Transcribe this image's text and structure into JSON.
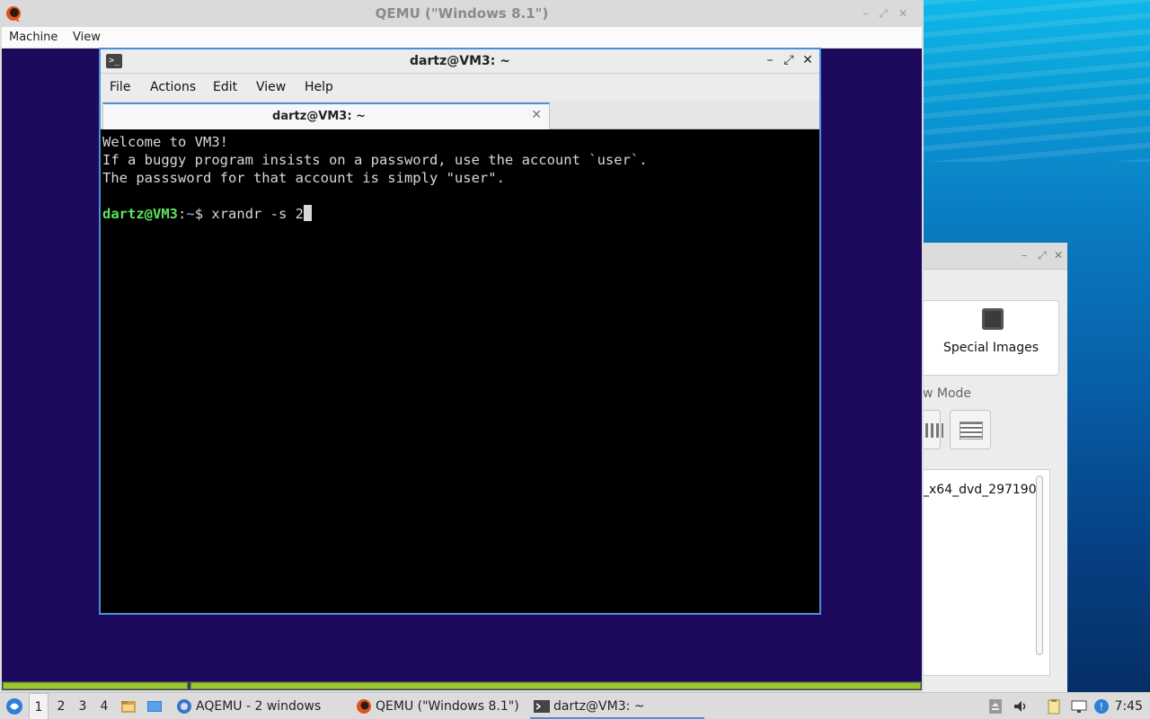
{
  "qemu": {
    "title": "QEMU (\"Windows 8.1\")",
    "menu": [
      "Machine",
      "View"
    ]
  },
  "terminal": {
    "title": "dartz@VM3: ~",
    "menu": [
      "File",
      "Actions",
      "Edit",
      "View",
      "Help"
    ],
    "tab_label": "dartz@VM3: ~",
    "lines": [
      "Welcome to VM3!",
      "If a buggy program insists on a password, use the account `user`.",
      "The passsword for that account is simply \"user\"."
    ],
    "prompt_user": "dartz@VM3",
    "prompt_sep": ":",
    "prompt_path": "~",
    "prompt_symbol": "$",
    "command": " xrandr -s 2"
  },
  "background_window": {
    "special_images_label": "Special Images",
    "view_mode_label": "w Mode",
    "list_item": "_x64_dvd_297190"
  },
  "taskbar": {
    "workspaces": [
      "1",
      "2",
      "3",
      "4"
    ],
    "active_workspace": "1",
    "tasks": [
      {
        "label": "AQEMU - 2 windows",
        "icon": "aqemu-icon"
      },
      {
        "label": "QEMU (\"Windows 8.1\")",
        "icon": "qemu-icon"
      },
      {
        "label": "dartz@VM3: ~",
        "icon": "terminal-icon"
      }
    ],
    "clock": "7:45"
  },
  "colors": {
    "accent": "#4a90d9",
    "guest_background": "#1d0a5c",
    "prompt_user": "#5ee35e",
    "prompt_path": "#5f8fe8",
    "progress": "#9ac72e"
  },
  "guest_progress_segments": [
    {
      "fill": 1.0
    },
    {
      "fill": 1.0
    }
  ]
}
